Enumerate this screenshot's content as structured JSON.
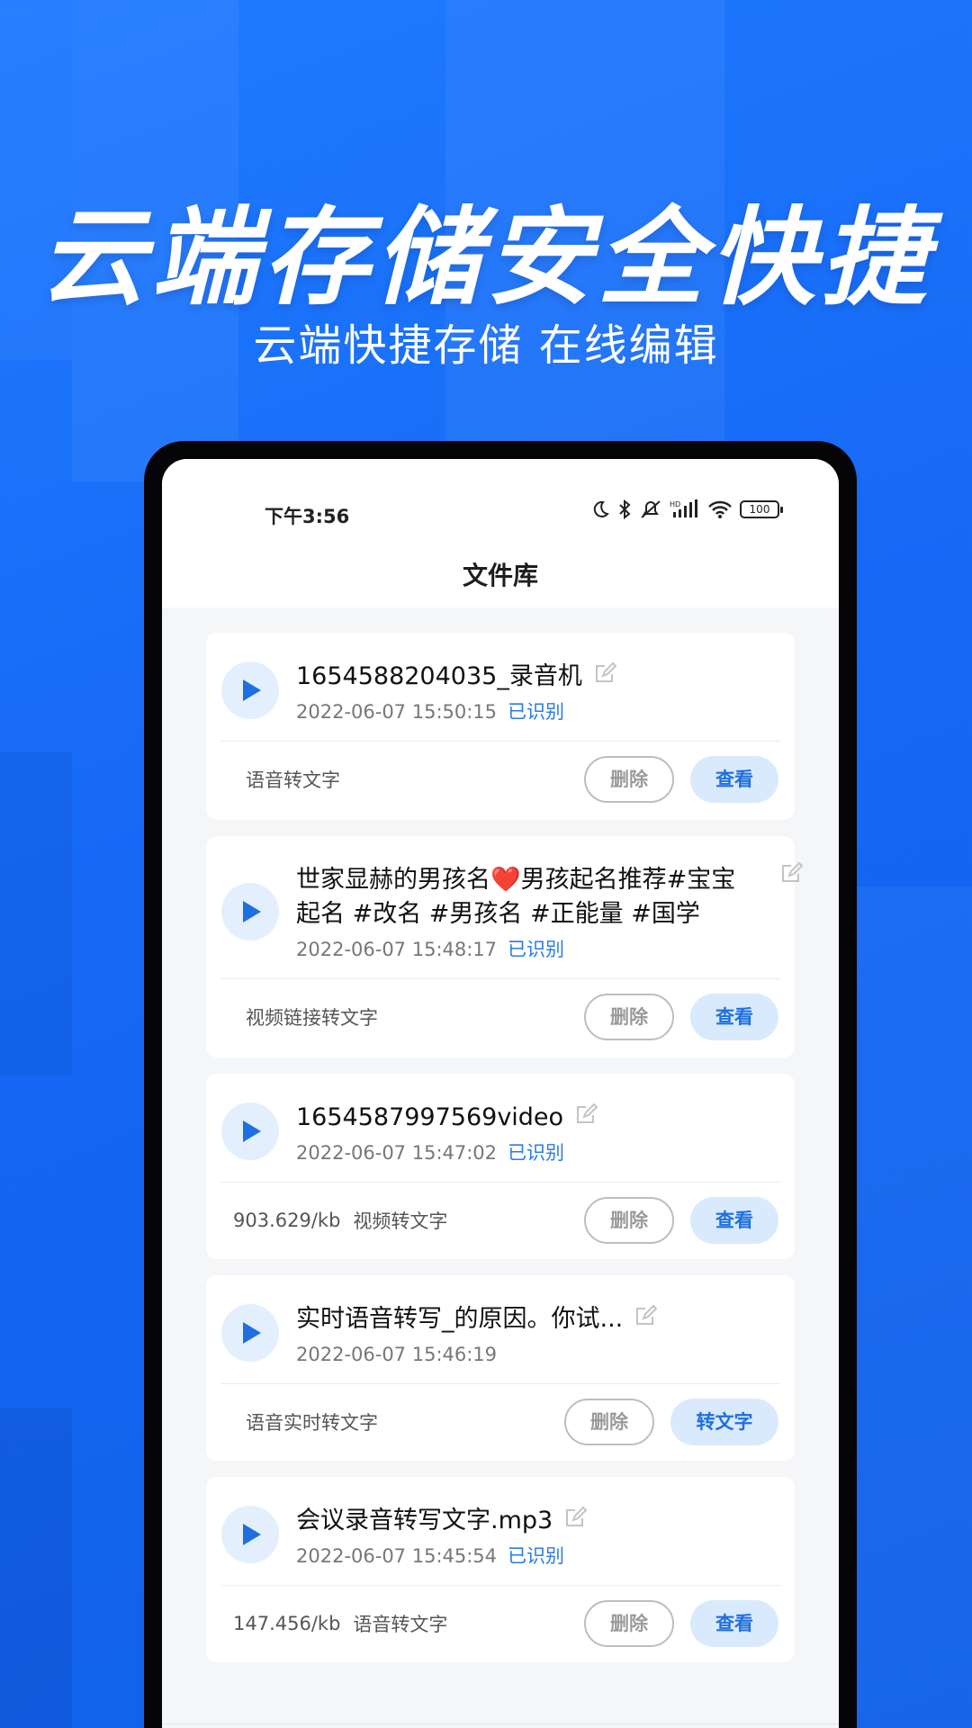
{
  "hero": {
    "title": "云端存储安全快捷",
    "subtitle": "云端快捷存储 在线编辑"
  },
  "status_bar": {
    "time": "下午3:56",
    "icons": [
      "moon-icon",
      "bluetooth-icon",
      "mute-icon",
      "hd-signal-icon",
      "wifi-icon",
      "battery-icon"
    ],
    "battery": "100"
  },
  "page": {
    "title": "文件库"
  },
  "colors": {
    "background": "#1668f5",
    "accent": "#2b7be8",
    "button_view_bg": "#d9eafd"
  },
  "files": [
    {
      "title": "1654588204035_录音机",
      "date": "2022-06-07 15:50:15",
      "status": "已识别",
      "size": "",
      "kind": "语音转文字",
      "delete_label": "删除",
      "action_label": "查看"
    },
    {
      "title": "世家显赫的男孩名❤️男孩起名推荐#宝宝起名 #改名 #男孩名 #正能量 #国学",
      "date": "2022-06-07 15:48:17",
      "status": "已识别",
      "size": "",
      "kind": "视频链接转文字",
      "delete_label": "删除",
      "action_label": "查看"
    },
    {
      "title": "1654587997569video",
      "date": "2022-06-07 15:47:02",
      "status": "已识别",
      "size": "903.629/kb",
      "kind": "视频转文字",
      "delete_label": "删除",
      "action_label": "查看"
    },
    {
      "title": "实时语音转写_的原因。你试...",
      "date": "2022-06-07 15:46:19",
      "status": "",
      "size": "",
      "kind": "语音实时转文字",
      "delete_label": "删除",
      "action_label": "转文字"
    },
    {
      "title": "会议录音转写文字.mp3",
      "date": "2022-06-07 15:45:54",
      "status": "已识别",
      "size": "147.456/kb",
      "kind": "语音转文字",
      "delete_label": "删除",
      "action_label": "查看"
    }
  ]
}
